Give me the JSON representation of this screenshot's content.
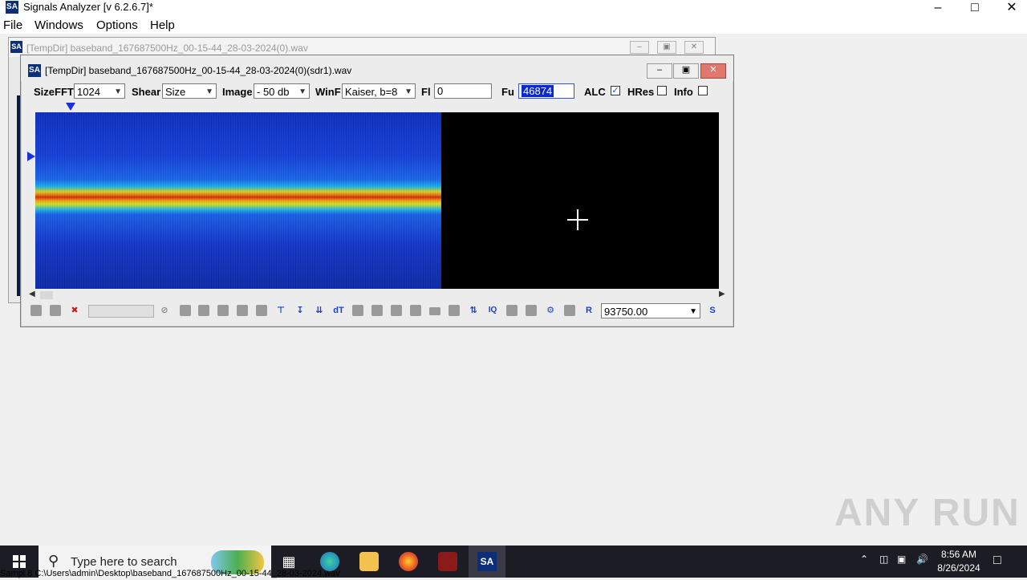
{
  "app": {
    "title": "Signals Analyzer [v 6.2.6.7]*",
    "icon_text": "SA"
  },
  "menu": [
    "File",
    "Windows",
    "Options",
    "Help"
  ],
  "bg_window": {
    "title": "[TempDir] baseband_167687500Hz_00-15-44_28-03-2024(0).wav"
  },
  "fg_window": {
    "title": "[TempDir] baseband_167687500Hz_00-15-44_28-03-2024(0)(sdr1).wav",
    "controls": {
      "sizefft_label": "SizeFFT",
      "sizefft_value": "1024",
      "shear_label": "Shear",
      "shear_value": "Size",
      "image_label": "Image",
      "image_value": "- 50 db",
      "winf_label": "WinF",
      "winf_value": "Kaiser, b=8",
      "fl_label": "Fl",
      "fl_value": "0",
      "fu_label": "Fu",
      "fu_value": "46874",
      "alc_label": "ALC",
      "alc_checked": true,
      "hres_label": "HRes",
      "hres_checked": false,
      "info_label": "Info",
      "info_checked": false
    },
    "toolbar": {
      "r_label": "R",
      "rate_value": "93750.00",
      "s_label": "S",
      "dt_label": "dT",
      "iq_label": "IQ"
    }
  },
  "taskbar": {
    "search_placeholder": "Type here to search",
    "time": "8:56 AM",
    "date": "8/26/2024",
    "behind_text": "Sampl                                               8      C:\\Users\\admin\\Desktop\\baseband_167687500Hz_00-15-44_28-03-2024.wav"
  },
  "watermark": "ANY RUN",
  "colors": {
    "accent_blue": "#0a28d6",
    "close_red": "#e0786d",
    "taskbar": "#1c1c24"
  }
}
